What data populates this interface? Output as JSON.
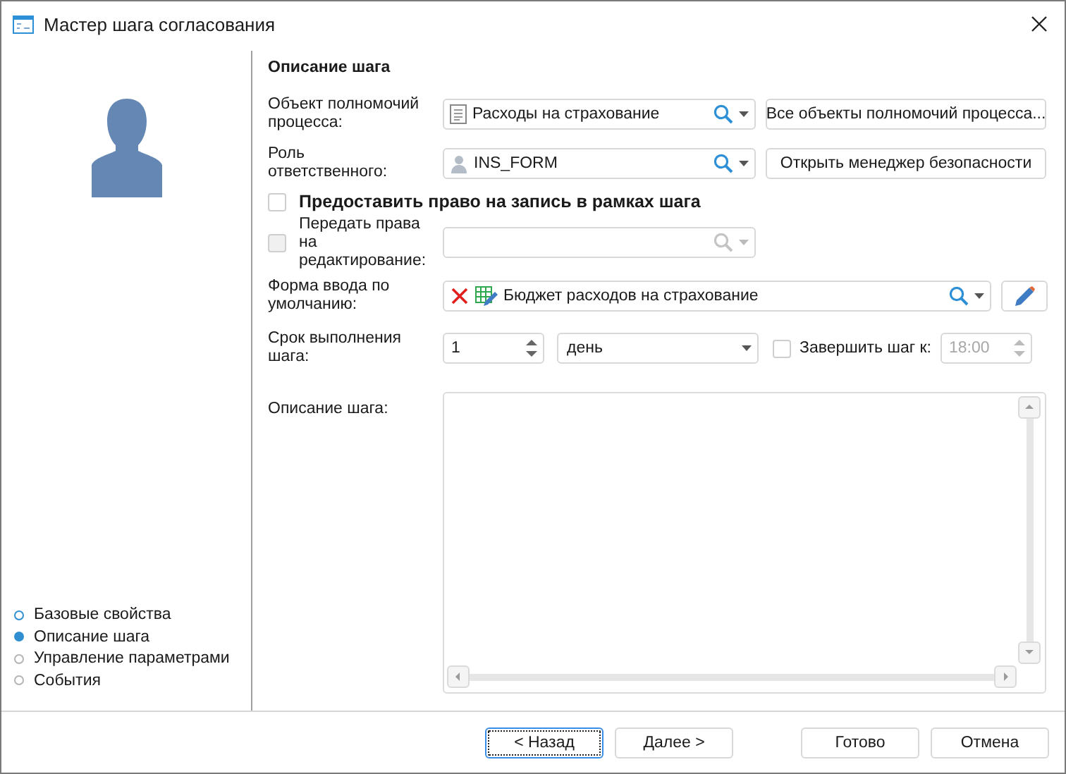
{
  "window": {
    "title": "Мастер шага согласования"
  },
  "steps": [
    {
      "label": "Базовые свойства",
      "selected": false,
      "visited": true
    },
    {
      "label": "Описание шага",
      "selected": true,
      "visited": true
    },
    {
      "label": "Управление параметрами",
      "selected": false,
      "visited": false
    },
    {
      "label": "События",
      "selected": false,
      "visited": false
    }
  ],
  "section_title": "Описание шага",
  "authority_object": {
    "label": "Объект полномочий процесса:",
    "value": "Расходы на страхование",
    "button": "Все объекты полномочий процесса..."
  },
  "role": {
    "label": "Роль ответственного:",
    "value": "INS_FORM",
    "button": "Открыть менеджер безопасности"
  },
  "grant_write": {
    "label": "Предоставить право на запись в рамках шага",
    "checked": false
  },
  "transfer_rights": {
    "label": "Передать права на редактирование:",
    "checked": false,
    "disabled": true
  },
  "default_form": {
    "label": "Форма ввода по умолчанию:",
    "value": "Бюджет расходов на страхование"
  },
  "deadline": {
    "label": "Срок выполнения шага:",
    "value": "1",
    "unit": "день",
    "finish_label": "Завершить шаг к:",
    "finish_checked": false,
    "finish_time": "18:00"
  },
  "description": {
    "label": "Описание шага:"
  },
  "buttons": [
    {
      "label": "< Назад",
      "focused": true
    },
    {
      "label": "Далее >",
      "focused": false
    },
    {
      "label": "Готово",
      "focused": false
    },
    {
      "label": "Отмена",
      "focused": false
    }
  ]
}
